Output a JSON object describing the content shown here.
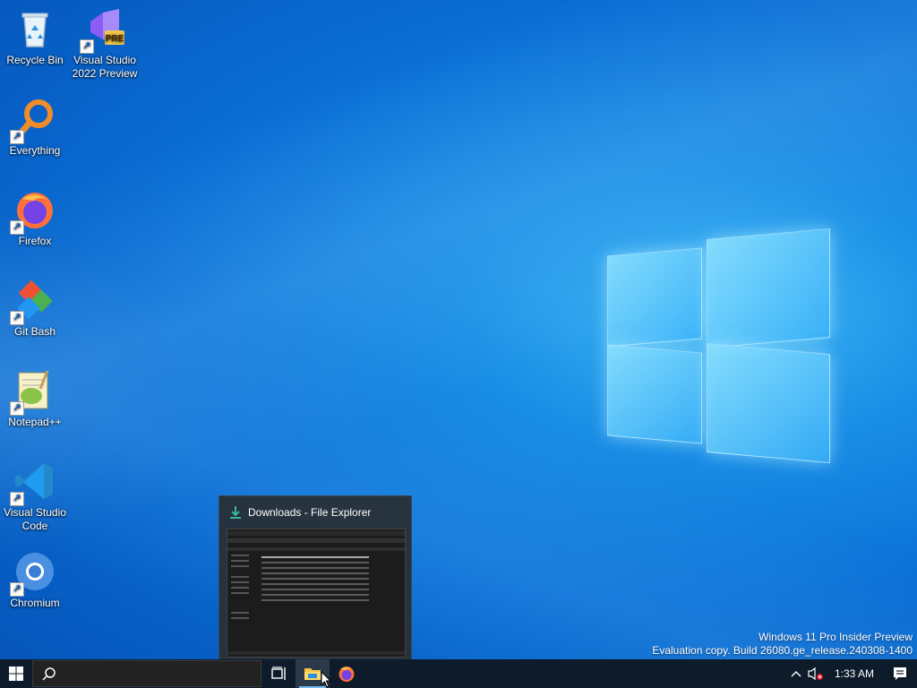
{
  "desktop": {
    "icons": [
      {
        "label": "Recycle Bin",
        "icon": "recycle-bin-icon"
      },
      {
        "label": "Visual Studio 2022 Preview",
        "icon": "visual-studio-icon",
        "badge": "PRE"
      },
      {
        "label": "Everything",
        "icon": "everything-search-icon"
      },
      {
        "label": "Firefox",
        "icon": "firefox-icon"
      },
      {
        "label": "Git Bash",
        "icon": "git-bash-icon"
      },
      {
        "label": "Notepad++",
        "icon": "notepad-plus-plus-icon"
      },
      {
        "label": "Visual Studio Code",
        "icon": "vscode-icon"
      },
      {
        "label": "Chromium",
        "icon": "chromium-icon"
      }
    ],
    "shortcut_glyph": "↗"
  },
  "watermark": {
    "line1": "Windows 11 Pro Insider Preview",
    "line2": "Evaluation copy. Build 26080.ge_release.240308-1400"
  },
  "preview": {
    "title": "Downloads - File Explorer",
    "icon": "download-icon"
  },
  "taskbar": {
    "start_icon": "windows-logo-icon",
    "search_icon": "search-icon",
    "taskview_icon": "task-view-icon",
    "apps": [
      {
        "name": "File Explorer",
        "icon": "folder-icon",
        "active": true
      },
      {
        "name": "Firefox",
        "icon": "firefox-icon",
        "active": false
      }
    ],
    "tray": {
      "chevron_icon": "chevron-up-icon",
      "volume_icon": "volume-muted-icon",
      "time": "1:33 AM",
      "notification_icon": "action-center-icon"
    }
  },
  "colors": {
    "taskbar": "#0d1b2a",
    "accent": "#76b9ed",
    "wallpaper": "#0a6fd6"
  }
}
